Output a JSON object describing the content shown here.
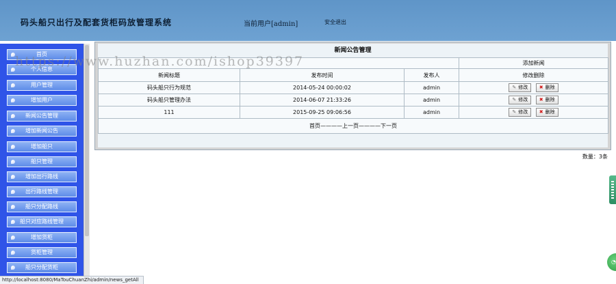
{
  "header": {
    "system_title": "码头船只出行及配套货柜码放管理系统",
    "current_user": "当前用户[admin]",
    "logout": "安全退出"
  },
  "sidebar": {
    "items": [
      "首页",
      "个人信息",
      "用户管理",
      "增加用户",
      "新闻公告管理",
      "增加新闻公告",
      "增加船只",
      "船只管理",
      "增加出行路线",
      "出行路线管理",
      "船只分配路线",
      "船只对应路线管理",
      "增加货柜",
      "货柜管理",
      "船只分配货柜"
    ]
  },
  "panel": {
    "title": "新闻公告管理",
    "add_link": "添加新闻",
    "columns": [
      "新闻标题",
      "发布时间",
      "发布人",
      "修改删除"
    ],
    "rows": [
      {
        "title": "码头船只行为规范",
        "time": "2014-05-24 00:00:02",
        "publisher": "admin"
      },
      {
        "title": "码头船只管理办法",
        "time": "2014-06-07 21:33:26",
        "publisher": "admin"
      },
      {
        "title": "111",
        "time": "2015-09-25 09:06:56",
        "publisher": "admin"
      }
    ],
    "edit_label": "修改",
    "delete_label": "删除",
    "pager": {
      "first": "首页",
      "prev": "上一页",
      "next": "下一页",
      "separator": "————"
    },
    "count_text": "数量：3条"
  },
  "status_bar": {
    "url": "http://localhost:8080/MaTouChuanZhi/admin/news_getAll"
  },
  "watermark": "https://www.huzhan.com/ishop39397",
  "icons": {
    "edit": "edit-icon",
    "delete": "delete-x-icon",
    "menu_bullet": "menu-bullet-icon"
  },
  "colors": {
    "header_bg": "#6ea2d2",
    "sidebar_bg": "#2f54e8",
    "menu_button": "#7aa2ee",
    "delete_icon": "#d11a1a"
  }
}
